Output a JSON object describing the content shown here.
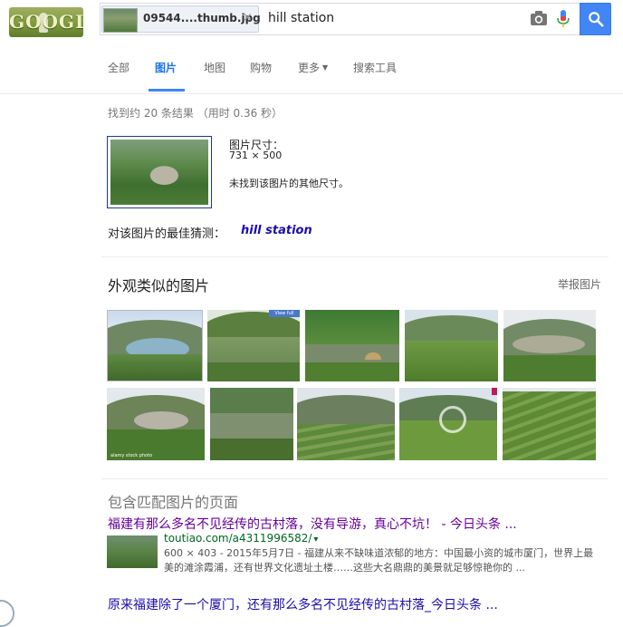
{
  "header": {
    "logo_text": "GOOGLE",
    "search": {
      "image_chip": {
        "filename": "09544....thumb.jpg",
        "remove_symbol": "×"
      },
      "query": "hill station"
    },
    "tabs": [
      {
        "label": "全部",
        "active": false
      },
      {
        "label": "图片",
        "active": true
      },
      {
        "label": "地图",
        "active": false
      },
      {
        "label": "购物",
        "active": false
      },
      {
        "label": "更多",
        "active": false,
        "has_dropdown": true
      },
      {
        "label": "搜索工具",
        "active": false
      }
    ],
    "icons": [
      "camera-icon",
      "microphone-icon",
      "search-icon"
    ],
    "colors": {
      "accent": "#4285f4"
    }
  },
  "stats": "找到约 20 条结果 （用时 0.36 秒）",
  "query_image": {
    "size_label": "图片尺寸：",
    "size_value": "731 × 500",
    "no_other_sizes": "未找到该图片的其他尺寸。"
  },
  "best_guess": {
    "label": "对该图片的最佳猜测：",
    "link": "hill station"
  },
  "similar": {
    "title": "外观类似的图片",
    "report": "举报图片",
    "images": [
      {
        "name": "similar-image-1"
      },
      {
        "name": "similar-image-2",
        "badge": "View full"
      },
      {
        "name": "similar-image-3"
      },
      {
        "name": "similar-image-4"
      },
      {
        "name": "similar-image-5"
      },
      {
        "name": "similar-image-6",
        "watermark": "alamy stock photo"
      },
      {
        "name": "similar-image-7"
      },
      {
        "name": "similar-image-8"
      },
      {
        "name": "similar-image-9"
      },
      {
        "name": "similar-image-10"
      }
    ]
  },
  "pages": {
    "title": "包含匹配图片的页面",
    "results": [
      {
        "title": "福建有那么多名不见经传的古村落，没有导游，真心不坑！ - 今日头条 ...",
        "url": "toutiao.com/a4311996582/",
        "url_caret": "▾",
        "snippet": "600 × 403 - 2015年5月7日 - 福建从来不缺味道浓郁的地方：中国最小资的城市厦门，世界上最美的滩涂霞浦，还有世界文化遗址土楼……这些大名鼎鼎的美景就足够惊艳你的 ..."
      },
      {
        "title": "原来福建除了一个厦门，还有那么多名不见经传的古村落_今日头条 ..."
      }
    ]
  }
}
